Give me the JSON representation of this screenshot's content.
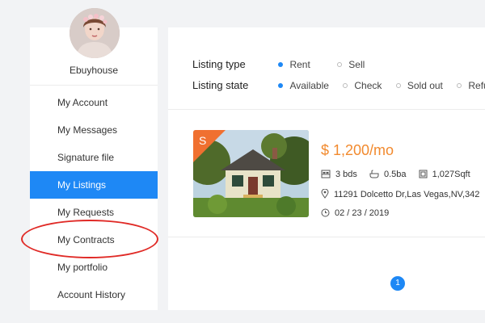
{
  "user": {
    "name": "Ebuyhouse"
  },
  "sidebar": {
    "items": [
      {
        "label": "My Account"
      },
      {
        "label": "My Messages"
      },
      {
        "label": "Signature file"
      },
      {
        "label": "My Listings",
        "active": true
      },
      {
        "label": "My Requests"
      },
      {
        "label": "My Contracts"
      },
      {
        "label": "My portfolio"
      },
      {
        "label": "Account History"
      }
    ]
  },
  "filters": {
    "type_label": "Listing type",
    "type_options": [
      {
        "label": "Rent",
        "selected": true
      },
      {
        "label": "Sell",
        "selected": false
      }
    ],
    "state_label": "Listing state",
    "state_options": [
      {
        "label": "Available",
        "selected": true
      },
      {
        "label": "Check",
        "selected": false
      },
      {
        "label": "Sold out",
        "selected": false
      },
      {
        "label": "Refused",
        "selected": false
      }
    ]
  },
  "listing": {
    "badge": "S",
    "price": "$ 1,200/mo",
    "beds": "3 bds",
    "baths": "0.5ba",
    "sqft": "1,027Sqft",
    "address": "11291 Dolcetto Dr,Las Vegas,NV,342",
    "date": "02 / 23 / 2019"
  },
  "pagination": {
    "current": "1"
  },
  "colors": {
    "accent": "#1e88f5",
    "price": "#f28a2e",
    "badge": "#f07030",
    "annotation": "#e02a26"
  }
}
